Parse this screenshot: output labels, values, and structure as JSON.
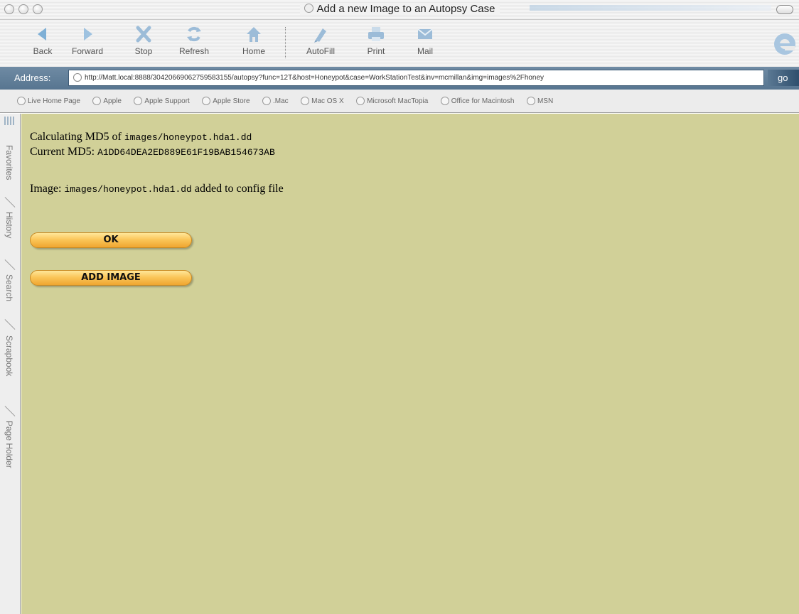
{
  "window": {
    "title": "Add a new Image to an Autopsy Case"
  },
  "toolbar": {
    "buttons": [
      {
        "label": "Back",
        "icon": "back-arrow-icon"
      },
      {
        "label": "Forward",
        "icon": "forward-arrow-icon"
      },
      {
        "label": "Stop",
        "icon": "stop-x-icon"
      },
      {
        "label": "Refresh",
        "icon": "refresh-icon"
      },
      {
        "label": "Home",
        "icon": "home-icon"
      },
      {
        "label": "AutoFill",
        "icon": "autofill-icon"
      },
      {
        "label": "Print",
        "icon": "printer-icon"
      },
      {
        "label": "Mail",
        "icon": "mail-icon"
      }
    ]
  },
  "address": {
    "label": "Address:",
    "url": "http://Matt.local:8888/304206690627​59583155/autopsy?func=12T&host=Honeypot&case=WorkStationTest&inv=mcmillan&img=images%2Fhoney",
    "go_label": "go"
  },
  "links": [
    "Live Home Page",
    "Apple",
    "Apple Support",
    "Apple Store",
    ".Mac",
    "Mac OS X",
    "Microsoft MacTopia",
    "Office for Macintosh",
    "MSN"
  ],
  "sidetabs": [
    "Favorites",
    "History",
    "Search",
    "Scrapbook",
    "Page Holder"
  ],
  "content": {
    "calc_prefix": "Calculating MD5 of ",
    "calc_path": "images/honeypot.hda1.dd",
    "md5_prefix": "Current MD5: ",
    "md5_value": "A1DD64DEA2ED889E61F19BAB154673AB",
    "image_prefix": "Image: ",
    "image_path": "images/honeypot.hda1.dd",
    "image_suffix": " added to config file",
    "ok_label": "OK",
    "add_image_label": "ADD IMAGE"
  },
  "colors": {
    "content_background": "#d1d098",
    "button_orange": "#fbc65a",
    "address_bar": "#577590"
  }
}
